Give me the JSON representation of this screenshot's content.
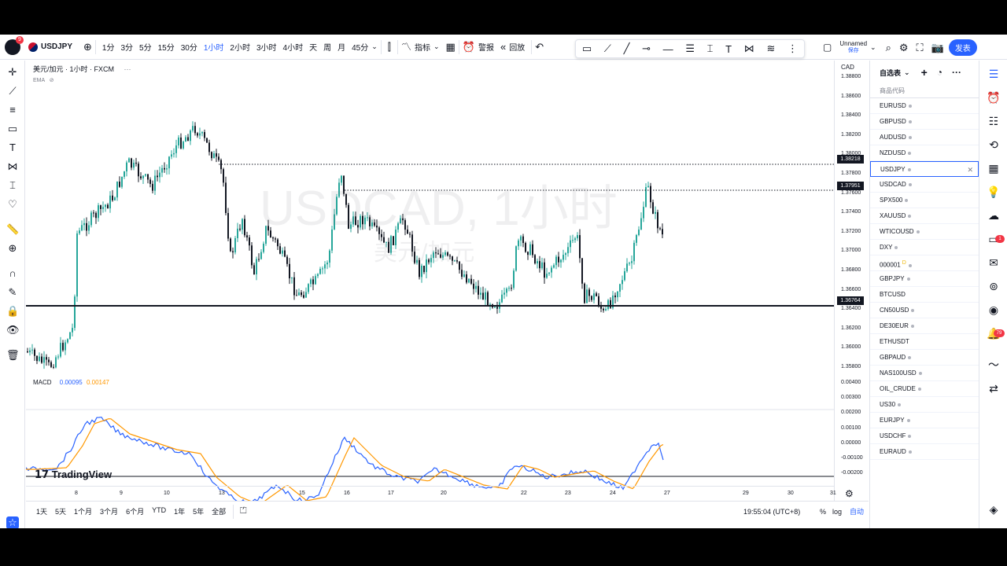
{
  "topbar": {
    "logo_badge": "9",
    "symbol": "USDJPY",
    "timeframes": [
      "1分",
      "3分",
      "5分",
      "15分",
      "30分",
      "1小时",
      "2小时",
      "3小时",
      "4小时",
      "天",
      "周",
      "月",
      "45分"
    ],
    "active_timeframe": "1小时",
    "indicators_label": "指标",
    "alert_label": "警报",
    "replay_label": "回放",
    "layout_name": "Unnamed",
    "save_label": "保存",
    "publish_label": "发表"
  },
  "legend": {
    "title": "美元/加元 · 1小时 · FXCM",
    "more": "···",
    "ema": "EMA",
    "watermark": "USDCAD, 1小时",
    "watermark_sub": "美元/加元"
  },
  "price_axis": {
    "currency": "CAD",
    "labels": [
      "1.38800",
      "1.38600",
      "1.38400",
      "1.38200",
      "1.38000",
      "1.37800",
      "1.37600",
      "1.37400",
      "1.37200",
      "1.37000",
      "1.36800",
      "1.36600",
      "1.36400",
      "1.36200",
      "1.36000",
      "1.35800"
    ],
    "badges": [
      "1.38218",
      "1.37951",
      "1.36764"
    ]
  },
  "macd": {
    "name": "MACD",
    "value1": "0.00095",
    "value2": "0.00147",
    "labels": [
      "0.00400",
      "0.00300",
      "0.00200",
      "0.00100",
      "0.00000",
      "-0.00100",
      "-0.00200"
    ]
  },
  "time_axis": {
    "labels": [
      "8",
      "9",
      "10",
      "13",
      "15",
      "16",
      "17",
      "20",
      "22",
      "23",
      "24",
      "27",
      "29",
      "30",
      "31"
    ]
  },
  "bottombar": {
    "ranges": [
      "1天",
      "5天",
      "1个月",
      "3个月",
      "6个月",
      "YTD",
      "1年",
      "5年",
      "全部"
    ],
    "time": "19:55:04 (UTC+8)",
    "percent": "%",
    "log": "log",
    "auto": "自动"
  },
  "watchlist": {
    "title": "自选表",
    "col_header": "商品代码",
    "items": [
      "EURUSD",
      "GBPUSD",
      "AUDUSD",
      "NZDUSD",
      "USDJPY",
      "USDCAD",
      "SPX500",
      "XAUUSD",
      "WTICOUSD",
      "DXY",
      "000001",
      "GBPJPY",
      "BTCUSD",
      "CN50USD",
      "DE30EUR",
      "ETHUSDT",
      "GBPAUD",
      "NAS100USD",
      "OIL_CRUDE",
      "US30",
      "EURJPY",
      "USDCHF",
      "EURAUD"
    ],
    "selected": "USDJPY",
    "d_label": "D"
  },
  "rightbar": {
    "badge_chat": "1",
    "badge_notify": "79"
  },
  "branding": "TradingView",
  "colors": {
    "accent": "#2962ff",
    "up": "#26a69a",
    "down": "#131722",
    "macd": "#2962ff",
    "signal": "#ff9800"
  }
}
